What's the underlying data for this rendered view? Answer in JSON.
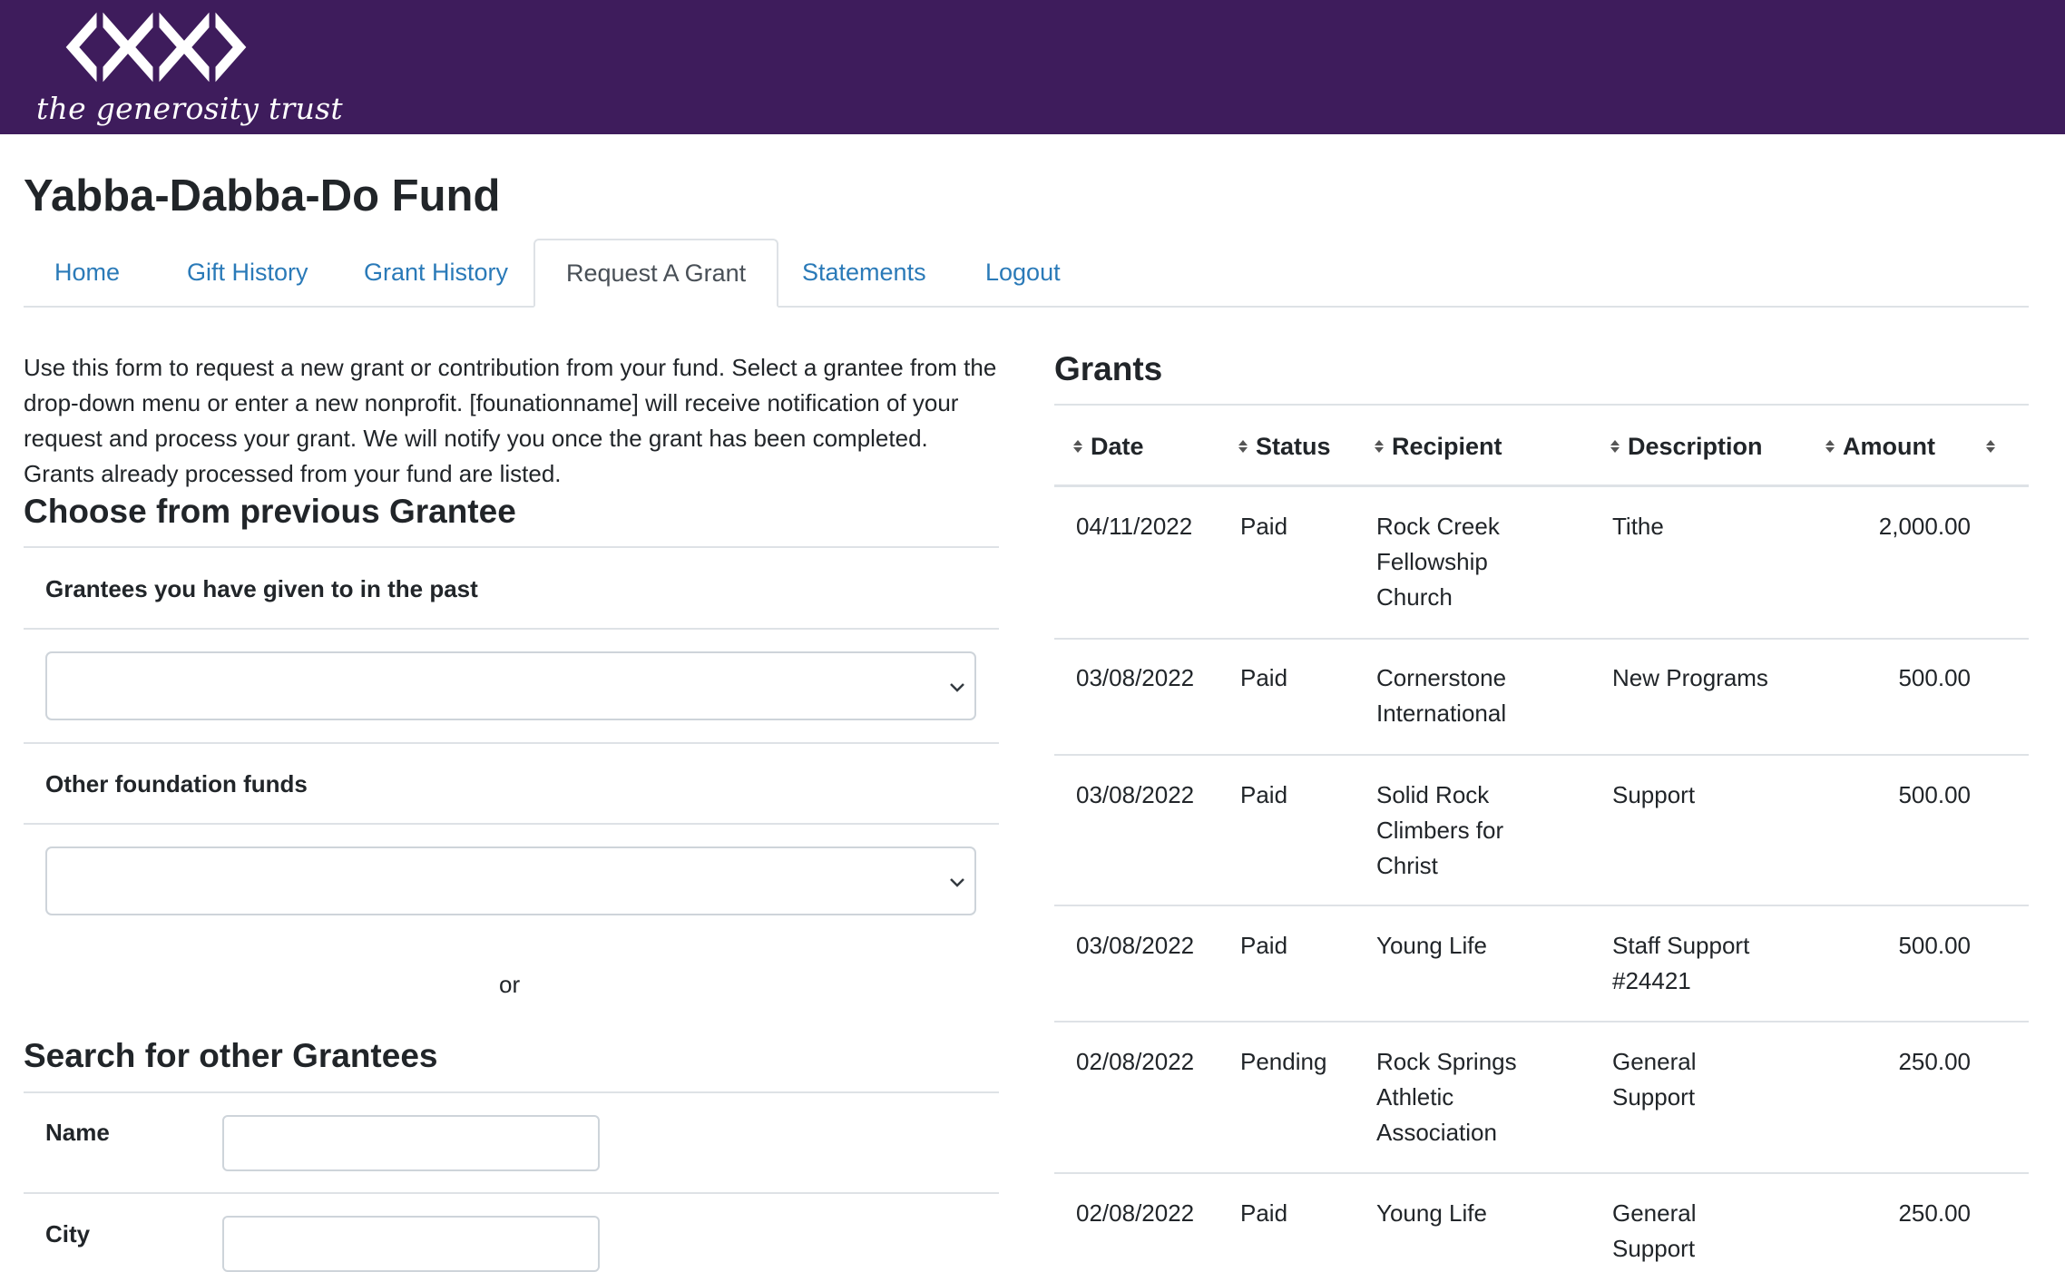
{
  "header": {
    "logo_text": "the generosity trust",
    "bg_color": "#3e1c5c"
  },
  "page": {
    "fund_title": "Yabba-Dabba-Do Fund"
  },
  "tabs": [
    {
      "label": "Home",
      "active": false
    },
    {
      "label": "Gift History",
      "active": false
    },
    {
      "label": "Grant History",
      "active": false
    },
    {
      "label": "Request A Grant",
      "active": true
    },
    {
      "label": "Statements",
      "active": false
    },
    {
      "label": "Logout",
      "active": false
    }
  ],
  "form": {
    "intro": "Use this form to request a new grant or contribution from your fund. Select a grantee from the drop-down menu or enter a new nonprofit. [founationname] will receive notification of your request and process your grant. We will notify you once the grant has been completed. Grants already processed from your fund are listed.",
    "previous_heading": "Choose from previous Grantee",
    "past_grantees_label": "Grantees you have given to in the past",
    "past_grantees_value": "",
    "other_funds_label": "Other foundation funds",
    "other_funds_value": "",
    "or_text": "or",
    "search_heading": "Search for other Grantees",
    "name_label": "Name",
    "name_value": "",
    "city_label": "City",
    "city_value": ""
  },
  "grants": {
    "title": "Grants",
    "columns": [
      "Date",
      "Status",
      "Recipient",
      "Description",
      "Amount"
    ],
    "rows": [
      {
        "date": "04/11/2022",
        "status": "Paid",
        "recipient": "Rock Creek Fellowship Church",
        "description": "Tithe",
        "amount": "2,000.00"
      },
      {
        "date": "03/08/2022",
        "status": "Paid",
        "recipient": "Cornerstone International",
        "description": "New Programs",
        "amount": "500.00"
      },
      {
        "date": "03/08/2022",
        "status": "Paid",
        "recipient": "Solid Rock Climbers for Christ",
        "description": "Support",
        "amount": "500.00"
      },
      {
        "date": "03/08/2022",
        "status": "Paid",
        "recipient": "Young Life",
        "description": "Staff Support #24421",
        "amount": "500.00"
      },
      {
        "date": "02/08/2022",
        "status": "Pending",
        "recipient": "Rock Springs Athletic Association",
        "description": "General Support",
        "amount": "250.00"
      },
      {
        "date": "02/08/2022",
        "status": "Paid",
        "recipient": "Young Life",
        "description": "General Support",
        "amount": "250.00"
      }
    ]
  }
}
